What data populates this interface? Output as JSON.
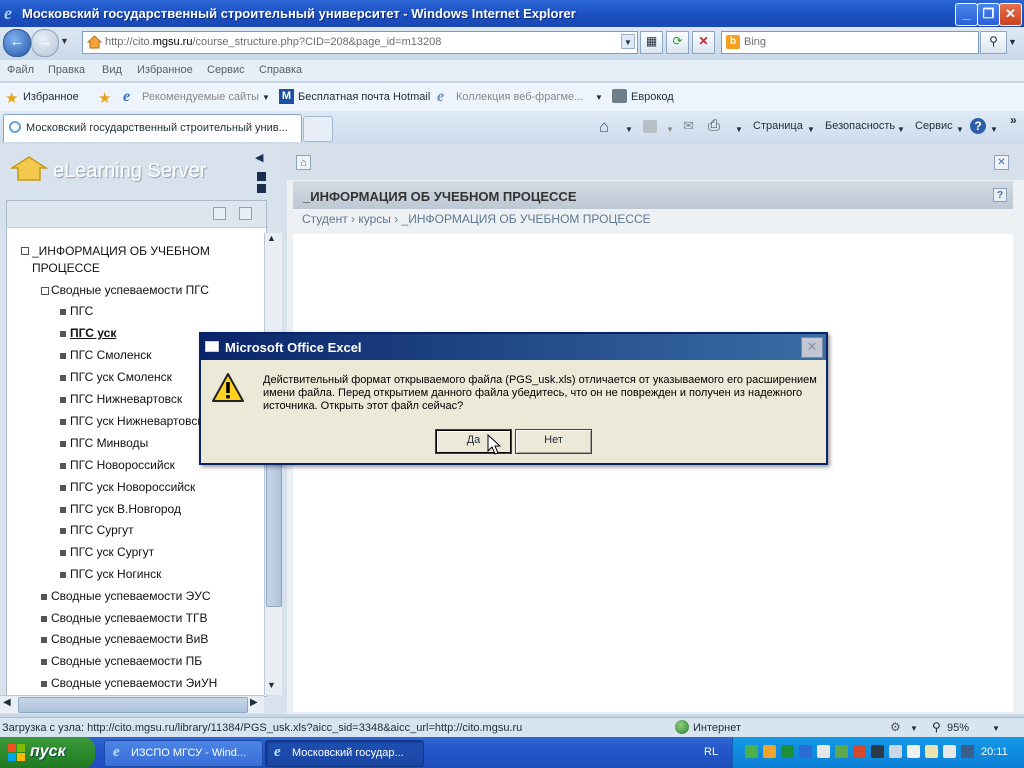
{
  "window": {
    "title": "Московский государственный строительный университет - Windows Internet Explorer"
  },
  "address": {
    "url_prefix": "http://cito.",
    "url_domain": "mgsu.ru",
    "url_rest": "/course_structure.php?CID=208&page_id=m13208",
    "search_placeholder": "Bing"
  },
  "menu": [
    "Файл",
    "Правка",
    "Вид",
    "Избранное",
    "Сервис",
    "Справка"
  ],
  "favorites": {
    "label": "Избранное",
    "items": [
      "Рекомендуемые сайты",
      "Бесплатная почта Hotmail",
      "Коллекция веб-фрагме...",
      "Еврокод"
    ]
  },
  "tabs": {
    "active": "Московский государственный строительный унив..."
  },
  "commandbar": [
    "Страница",
    "Безопасность",
    "Сервис"
  ],
  "sidebar": {
    "logo_text": "eLearning Server",
    "root_line1": "_ИНФОРМАЦИЯ ОБ УЧЕБНОМ",
    "root_line2": "ПРОЦЕССЕ",
    "group_open": "Сводные успеваемости ПГС",
    "children": [
      "ПГС",
      "ПГС уск",
      "ПГС Смоленск",
      "ПГС уск Смоленск",
      "ПГС Нижневартовск",
      "ПГС уск Нижневартовск",
      "ПГС Минводы",
      "ПГС Новороссийск",
      "ПГС уск Новороссийск",
      "ПГС уск В.Новгород",
      "ПГС Сургут",
      "ПГС уск Сургут",
      "ПГС уск Ногинск"
    ],
    "groups": [
      "Сводные успеваемости ЭУС",
      "Сводные успеваемости ТГВ",
      "Сводные успеваемости ВиВ",
      "Сводные успеваемости ПБ",
      "Сводные успеваемости ЭиУН"
    ]
  },
  "content": {
    "panel_title": "_ИНФОРМАЦИЯ ОБ УЧЕБНОМ ПРОЦЕССЕ",
    "breadcrumb": "Студент  ›  курсы  ›  _ИНФОРМАЦИЯ ОБ УЧЕБНОМ ПРОЦЕССЕ"
  },
  "dialog": {
    "title": "Microsoft Office Excel",
    "message": "Действительный формат открываемого файла (PGS_usk.xls) отличается от указываемого его расширением имени файла. Перед открытием данного файла убедитесь, что он не поврежден и получен из надежного источника. Открыть этот файл сейчас?",
    "yes": "Да",
    "no": "Нет"
  },
  "status": {
    "text": "Загрузка с узла: http://cito.mgsu.ru/library/11384/PGS_usk.xls?aicc_sid=3348&aicc_url=http://cito.mgsu.ru",
    "zone": "Интернет",
    "zoom": "95%"
  },
  "taskbar": {
    "start": "пуск",
    "items": [
      "ИЗСПО МГСУ - Wind...",
      "Московский государ..."
    ],
    "lang": "RL",
    "clock": "20:11"
  }
}
